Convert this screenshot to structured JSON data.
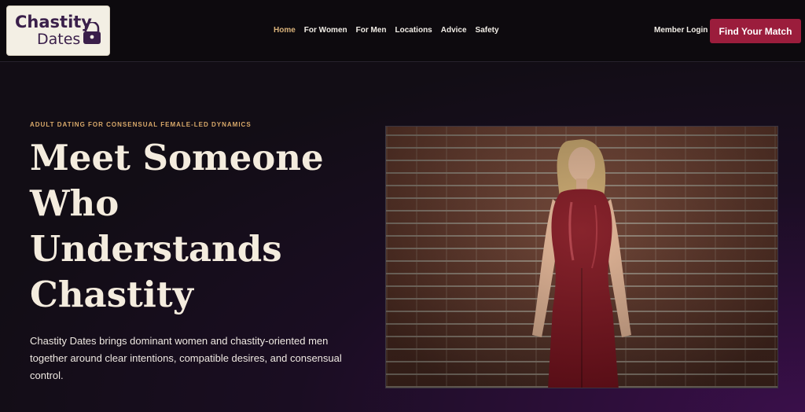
{
  "brand": {
    "line1": "Chastity",
    "line2": "Dates"
  },
  "nav": {
    "items": [
      {
        "label": "Home",
        "active": true
      },
      {
        "label": "For Women"
      },
      {
        "label": "For Men"
      },
      {
        "label": "Locations"
      },
      {
        "label": "Advice"
      },
      {
        "label": "Safety"
      }
    ],
    "member_login": "Member Login",
    "cta": "Find Your Match"
  },
  "hero": {
    "eyebrow": "ADULT DATING FOR CONSENSUAL FEMALE-LED DYNAMICS",
    "headline": "Meet Someone Who Understands Chastity",
    "lede": "Chastity Dates brings dominant women and chastity-oriented men together around clear intentions, compatible desires, and consensual control."
  },
  "colors": {
    "accent": "#d9b27a",
    "cta_bg": "#9b1d3c",
    "header_bg": "#0d0a0e",
    "hero_glow": "#3a0f4a"
  }
}
